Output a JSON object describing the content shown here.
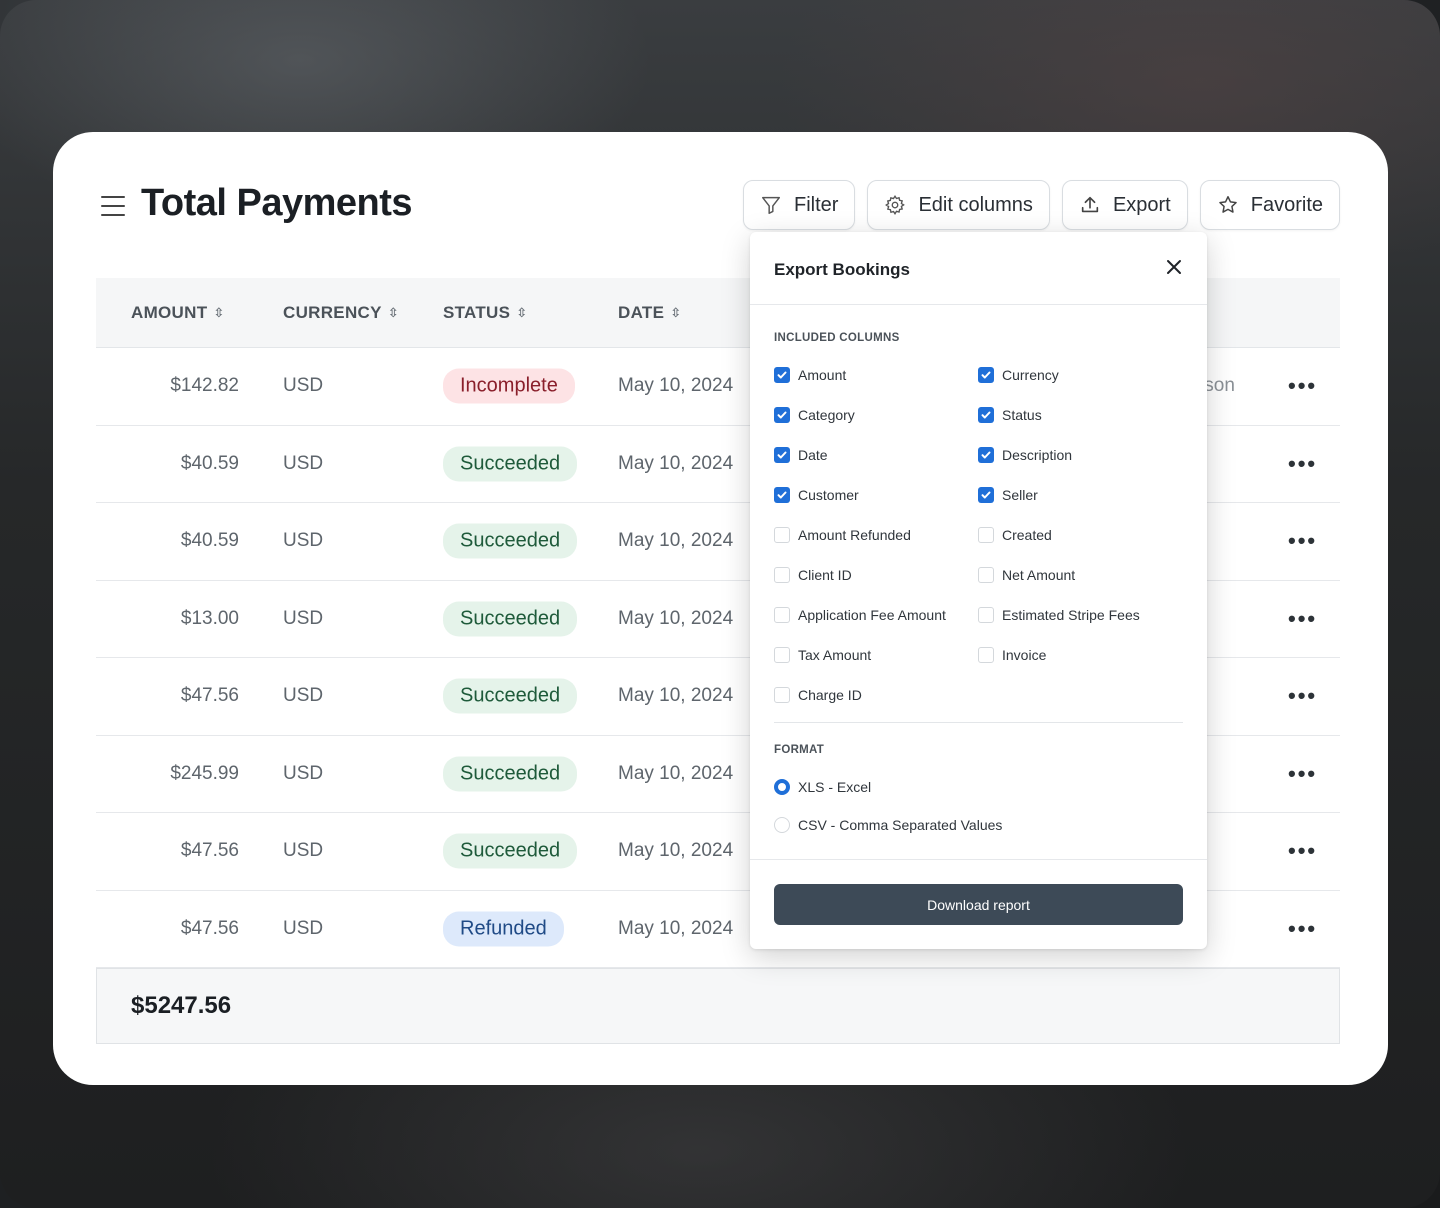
{
  "header": {
    "title": "Total Payments",
    "toolbar": {
      "filter_label": "Filter",
      "edit_columns_label": "Edit columns",
      "export_label": "Export",
      "favorite_label": "Favorite"
    }
  },
  "table": {
    "columns": [
      "AMOUNT",
      "CURRENCY",
      "STATUS",
      "DATE"
    ],
    "rows": [
      {
        "amount": "$142.82",
        "currency": "USD",
        "status": "Incomplete",
        "date": "May 10, 2024",
        "partial": "tson"
      },
      {
        "amount": "$40.59",
        "currency": "USD",
        "status": "Succeeded",
        "date": "May 10, 2024",
        "partial": ""
      },
      {
        "amount": "$40.59",
        "currency": "USD",
        "status": "Succeeded",
        "date": "May 10, 2024",
        "partial": ""
      },
      {
        "amount": "$13.00",
        "currency": "USD",
        "status": "Succeeded",
        "date": "May 10, 2024",
        "partial": ""
      },
      {
        "amount": "$47.56",
        "currency": "USD",
        "status": "Succeeded",
        "date": "May 10, 2024",
        "partial": ""
      },
      {
        "amount": "$245.99",
        "currency": "USD",
        "status": "Succeeded",
        "date": "May 10, 2024",
        "partial": ""
      },
      {
        "amount": "$47.56",
        "currency": "USD",
        "status": "Succeeded",
        "date": "May 10, 2024",
        "partial": ""
      },
      {
        "amount": "$47.56",
        "currency": "USD",
        "status": "Refunded",
        "date": "May 10, 2024",
        "partial": ""
      }
    ],
    "row_menu": "•••",
    "total": "$5247.56"
  },
  "export_popup": {
    "title": "Export Bookings",
    "included_columns_label": "INCLUDED COLUMNS",
    "columns_left": [
      {
        "label": "Amount",
        "checked": true
      },
      {
        "label": "Category",
        "checked": true
      },
      {
        "label": "Date",
        "checked": true
      },
      {
        "label": "Customer",
        "checked": true
      },
      {
        "label": "Amount Refunded",
        "checked": false
      },
      {
        "label": "Client ID",
        "checked": false
      },
      {
        "label": "Application Fee Amount",
        "checked": false
      },
      {
        "label": "Tax Amount",
        "checked": false
      },
      {
        "label": "Charge ID",
        "checked": false
      }
    ],
    "columns_right": [
      {
        "label": "Currency",
        "checked": true
      },
      {
        "label": "Status",
        "checked": true
      },
      {
        "label": "Description",
        "checked": true
      },
      {
        "label": "Seller",
        "checked": true
      },
      {
        "label": "Created",
        "checked": false
      },
      {
        "label": "Net Amount",
        "checked": false
      },
      {
        "label": "Estimated Stripe Fees",
        "checked": false
      },
      {
        "label": "Invoice",
        "checked": false
      }
    ],
    "format_label": "FORMAT",
    "formats": [
      {
        "label": "XLS - Excel",
        "selected": true
      },
      {
        "label": "CSV - Comma Separated Values",
        "selected": false
      }
    ],
    "download_label": "Download report"
  },
  "colors": {
    "accent": "#1f6fd8",
    "download_button": "#3d4a57",
    "incomplete_bg": "#fde3e5",
    "succeeded_bg": "#e5f3ea",
    "refunded_bg": "#dde9fb"
  }
}
